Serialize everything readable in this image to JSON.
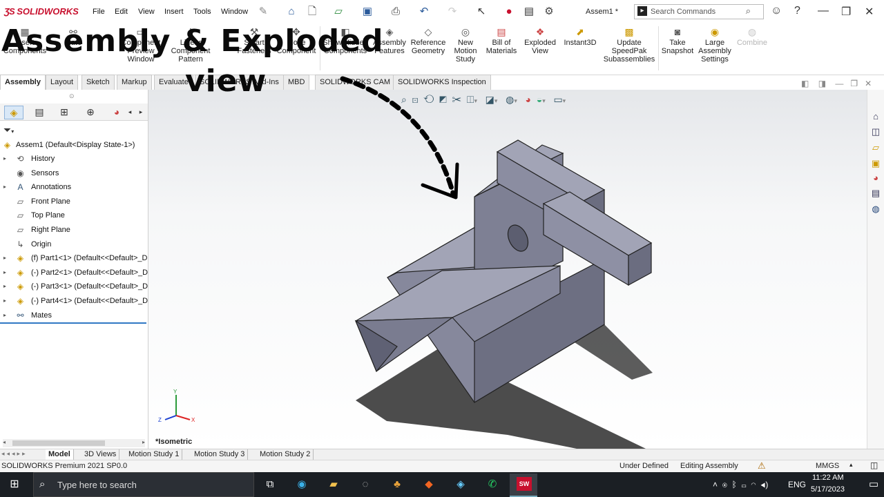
{
  "app": {
    "logo": "SOLIDWORKS",
    "menu": [
      "File",
      "Edit",
      "View",
      "Insert",
      "Tools",
      "Window"
    ],
    "doc_title": "Assem1 *",
    "search_placeholder": "Search Commands"
  },
  "overlay": {
    "line1": "Assembly & Exploded",
    "line2": "view"
  },
  "commands": {
    "insert_components": "Insert Components",
    "mate": "Mate",
    "component_preview": "Component Preview Window",
    "linear_pattern": "Linear Component Pattern",
    "smart_fasteners": "Smart Fasteners",
    "move_component": "Move Component",
    "show_hidden": "Show Hidden Components",
    "assembly_features": "Assembly Features",
    "reference_geometry": "Reference Geometry",
    "new_motion_study": "New Motion Study",
    "bill_of_materials": "Bill of Materials",
    "exploded_view": "Exploded View",
    "instant3d": "Instant3D",
    "update_speedpak": "Update SpeedPak Subassemblies",
    "take_snapshot": "Take Snapshot",
    "large_assembly": "Large Assembly Settings",
    "combine": "Combine"
  },
  "tabs": [
    "Assembly",
    "Layout",
    "Sketch",
    "Markup",
    "Evaluate",
    "SOLIDWORKS Add-Ins",
    "MBD",
    "SOLIDWORKS CAM",
    "SOLIDWORKS Inspection"
  ],
  "tree": {
    "root": "Assem1  (Default<Display State-1>)",
    "items": [
      {
        "label": "History",
        "icon": "history-icon"
      },
      {
        "label": "Sensors",
        "icon": "sensors-icon"
      },
      {
        "label": "Annotations",
        "icon": "annotations-icon"
      },
      {
        "label": "Front Plane",
        "icon": "plane-icon"
      },
      {
        "label": "Top Plane",
        "icon": "plane-icon"
      },
      {
        "label": "Right Plane",
        "icon": "plane-icon"
      },
      {
        "label": "Origin",
        "icon": "origin-icon"
      },
      {
        "label": "(f) Part1<1> (Default<<Default>_D",
        "icon": "part-icon"
      },
      {
        "label": "(-) Part2<1> (Default<<Default>_D",
        "icon": "part-icon"
      },
      {
        "label": "(-) Part3<1> (Default<<Default>_D",
        "icon": "part-icon"
      },
      {
        "label": "(-) Part4<1> (Default<<Default>_D",
        "icon": "part-icon"
      },
      {
        "label": "Mates",
        "icon": "mates-icon"
      }
    ]
  },
  "viewport": {
    "view_label": "*Isometric",
    "triad": {
      "x": "X",
      "y": "Y",
      "z": "Z"
    }
  },
  "bottom_tabs": [
    "Model",
    "3D Views",
    "Motion Study 1",
    "Motion Study 3",
    "Motion Study 2"
  ],
  "status": {
    "version": "SOLIDWORKS Premium 2021 SP0.0",
    "defined": "Under Defined",
    "mode": "Editing Assembly",
    "units": "MMGS"
  },
  "taskbar": {
    "search_placeholder": "Type here to search",
    "lang": "ENG",
    "time": "11:22 AM",
    "date": "5/17/2023"
  },
  "colors": {
    "brand_red": "#c8102e",
    "model_face_top": "#a2a4b6",
    "model_face_front": "#86889c",
    "model_face_side": "#6b6d80",
    "taskbar": "#1b1f24"
  }
}
